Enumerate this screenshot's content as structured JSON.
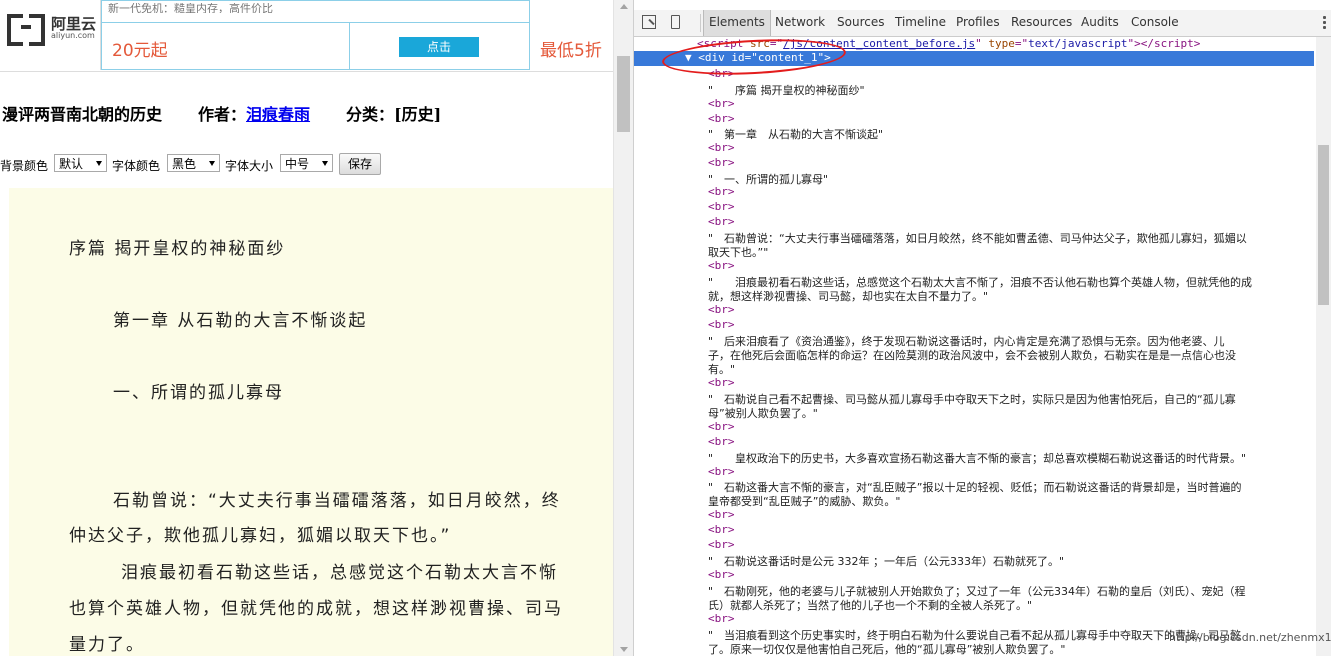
{
  "ad": {
    "logo_cn": "阿里云",
    "logo_en": "aliyun.com",
    "tagline": "新一代免机：糙皇内存，高件价比",
    "price": "20元起",
    "button": "点击",
    "discount": "最低5折"
  },
  "book": {
    "title": "漫评两晋南北朝的历史",
    "author_label": "作者：",
    "author": "泪痕春雨",
    "category_label": "分类：",
    "category": "[历史]"
  },
  "settings": {
    "bg_label": "背景颜色",
    "bg_value": "默认",
    "font_color_label": "字体颜色",
    "font_color_value": "黑色",
    "font_size_label": "字体大小",
    "font_size_value": "中号",
    "save_label": "保存"
  },
  "reader": {
    "lines": [
      "序篇 揭开皇权的神秘面纱",
      "第一章 从石勒的大言不惭谈起",
      "一、所谓的孤儿寡母",
      "石勒曾说：“大丈夫行事当礌礌落落，如日月皎然，终",
      "仲达父子，欺他孤儿寡妇，狐媚以取天下也。”",
      "泪痕最初看石勒这些话，总感觉这个石勒太大言不惭",
      "也算个英雄人物，但就凭他的成就，想这样渺视曹操、司马",
      "量力了。"
    ]
  },
  "devtools": {
    "tabs": [
      "Elements",
      "Network",
      "Sources",
      "Timeline",
      "Profiles",
      "Resources",
      "Audits",
      "Console"
    ],
    "active_tab": "Elements",
    "script_src": "/js/content_content_before.js",
    "script_type": "text/javascript",
    "div_id": "content_1",
    "texts": [
      "\"　　序篇 揭开皇权的神秘面纱\"",
      "\"　第一章　从石勒的大言不惭谈起\"",
      "\"　一、所谓的孤儿寡母\"",
      "\"　石勒曾说：“大丈夫行事当礌礌落落，如日月皎然，终不能如曹孟德、司马仲达父子，欺他孤儿寡妇，狐媚以",
      "取天下也。”\"",
      "\"　　泪痕最初看石勒这些话，总感觉这个石勒太大言不惭了，泪痕不否认他石勒也算个英雄人物，但就凭他的成",
      "就，想这样渺视曹操、司马懿，却也实在太自不量力了。\"",
      "\"　后来泪痕看了《资治通鉴》，终于发现石勒说这番话时，内心肯定是充满了恐惧与无奈。因为他老婆、儿",
      "子，在他死后会面临怎样的命运？在凶险莫测的政治风波中，会不会被别人欺负，石勒实在是是一点信心也没",
      "有。\"",
      "\"　石勒说自己看不起曹操、司马懿从孤儿寡母手中夺取天下之时，实际只是因为他害怕死后，自己的“孤儿寡",
      "母”被别人欺负罢了。\"",
      "\"　　皇权政治下的历史书，大多喜欢宣扬石勒这番大言不惭的豪言；却总喜欢模糊石勒说这番话的时代背景。\"",
      "\"　石勒这番大言不惭的豪言，对“乱臣贼子”报以十足的轻视、贬低；而石勒说这番话的背景却是，当时普遍的",
      "皇帝都受到“乱臣贼子”的威胁、欺负。\"",
      "\"　石勒说这番话时是公元 332年 ；一年后（公元333年）石勒就死了。\"",
      "\"　石勒刚死，他的老婆与儿子就被别人开始欺负了；又过了一年（公元334年）石勒的皇后（刘氏）、宠妃（程",
      "氏）就都人杀死了；当然了他的儿子也一个不剩的全被人杀死了。\"",
      "\"　当泪痕看到这个历史事实时，终于明白石勒为什么要说自己看不起从孤儿寡母手中夺取天下的曹操、司马懿",
      "了。原来一切仅仅是他害怕自己死后，他的“孤儿寡母”被别人欺负罢了。\""
    ],
    "br": "<br>"
  },
  "watermark": "http://blog.csdn.net/zhenmx1"
}
